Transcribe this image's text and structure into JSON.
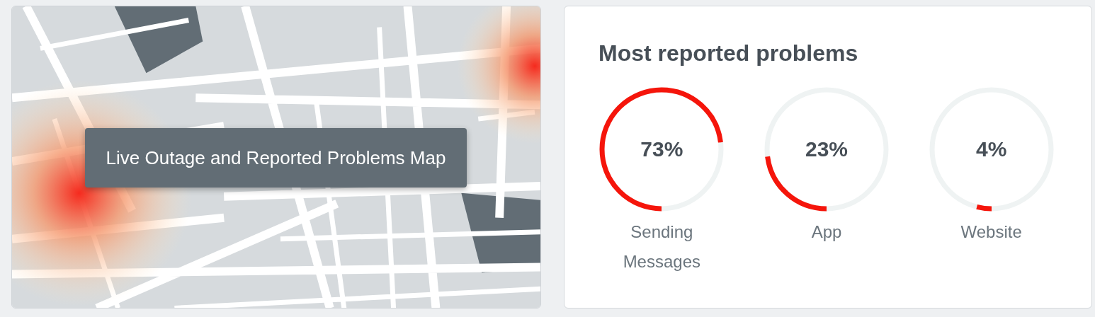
{
  "map": {
    "kind": "picture",
    "label": "Live Outage and Reported Problems Map"
  },
  "problems": {
    "title": "Most reported problems",
    "items": [
      {
        "reading": "73%",
        "level": 0.73,
        "label": "Sending Messages"
      },
      {
        "reading": "23%",
        "level": 0.23,
        "label": "App"
      },
      {
        "reading": "4%",
        "level": 0.04,
        "label": "Website"
      }
    ]
  }
}
